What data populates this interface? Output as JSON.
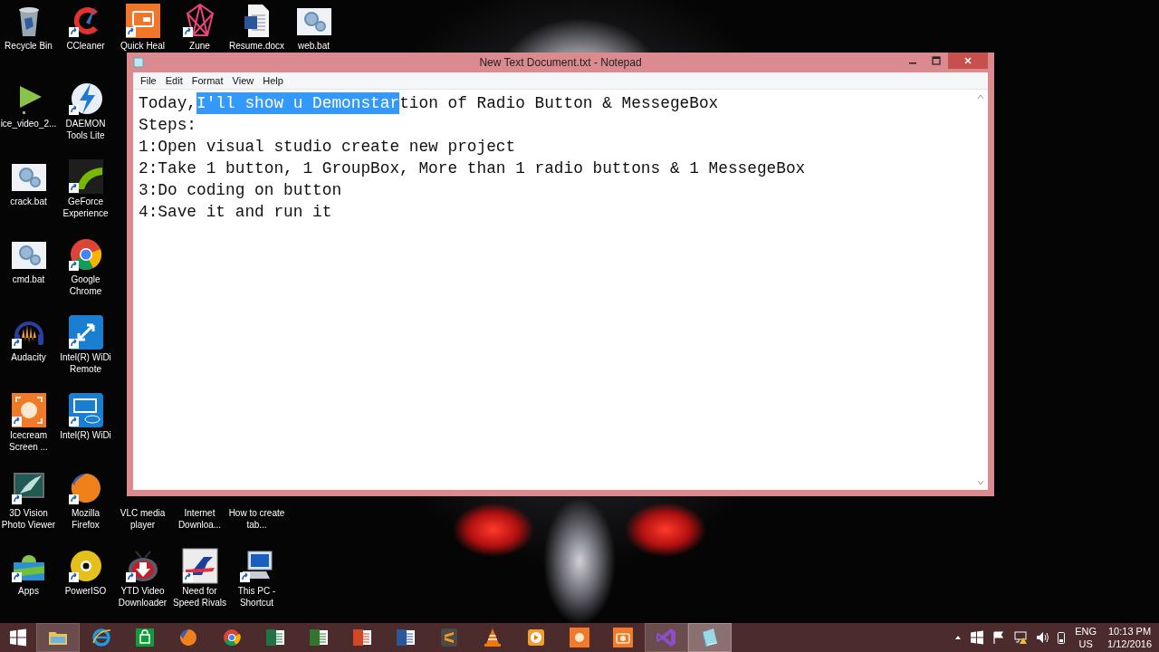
{
  "desktop_rows": [
    [
      {
        "label": "Recycle Bin",
        "kind": "bin",
        "shortcut": false
      },
      {
        "label": "CCleaner",
        "kind": "ccleaner",
        "shortcut": true
      },
      {
        "label": "Quick Heal",
        "kind": "quickheal",
        "shortcut": true
      },
      {
        "label": "Zune",
        "kind": "zune",
        "shortcut": true
      },
      {
        "label": "Resume.docx",
        "kind": "worddoc",
        "shortcut": false
      },
      {
        "label": "web.bat",
        "kind": "bat",
        "shortcut": false
      }
    ],
    [
      {
        "label": "ice_video_2...",
        "kind": "play",
        "shortcut": false
      },
      {
        "label": "DAEMON Tools Lite",
        "kind": "daemon",
        "shortcut": true
      }
    ],
    [
      {
        "label": "crack.bat",
        "kind": "bat",
        "shortcut": false
      },
      {
        "label": "GeForce Experience",
        "kind": "nvidia",
        "shortcut": true
      }
    ],
    [
      {
        "label": "cmd.bat",
        "kind": "bat",
        "shortcut": false
      },
      {
        "label": "Google Chrome",
        "kind": "chrome",
        "shortcut": true
      }
    ],
    [
      {
        "label": "Audacity",
        "kind": "audacity",
        "shortcut": true
      },
      {
        "label": "Intel(R) WiDi Remote",
        "kind": "intelremote",
        "shortcut": true
      }
    ],
    [
      {
        "label": "Icecream Screen ...",
        "kind": "icecream",
        "shortcut": true
      },
      {
        "label": "Intel(R) WiDi",
        "kind": "intelwidi",
        "shortcut": true
      }
    ],
    [
      {
        "label": "3D Vision Photo Viewer",
        "kind": "vision",
        "shortcut": true
      },
      {
        "label": "Mozilla Firefox",
        "kind": "firefox",
        "shortcut": true
      },
      {
        "label": "VLC media player"
      },
      {
        "label": "Internet Downloa..."
      },
      {
        "label": "How to create tab..."
      }
    ],
    [
      {
        "label": "Apps",
        "kind": "android",
        "shortcut": true
      },
      {
        "label": "PowerISO",
        "kind": "disc",
        "shortcut": true
      },
      {
        "label": "YTD Video Downloader",
        "kind": "ytd",
        "shortcut": true
      },
      {
        "label": "Need for Speed Rivals",
        "kind": "nfs",
        "shortcut": true
      },
      {
        "label": "This PC - Shortcut",
        "kind": "pc",
        "shortcut": true
      }
    ]
  ],
  "window": {
    "title": "New Text Document.txt - Notepad",
    "menu": [
      "File",
      "Edit",
      "Format",
      "View",
      "Help"
    ],
    "lines": [
      {
        "segments": [
          {
            "text": "Today,",
            "selected": false
          },
          {
            "text": "I'll show u Demonstar",
            "selected": true
          },
          {
            "text": "tion of Radio Button & MessegeBox",
            "selected": false
          }
        ]
      },
      {
        "segments": [
          {
            "text": "Steps:",
            "selected": false
          }
        ]
      },
      {
        "segments": [
          {
            "text": "1:Open visual studio create new project",
            "selected": false
          }
        ]
      },
      {
        "segments": [
          {
            "text": "2:Take 1 button, 1 GroupBox, More than 1 radio buttons & 1 MessegeBox",
            "selected": false
          }
        ]
      },
      {
        "segments": [
          {
            "text": "3:Do coding on button",
            "selected": false
          }
        ]
      },
      {
        "segments": [
          {
            "text": "4:Save it and run it",
            "selected": false
          }
        ]
      }
    ]
  },
  "taskbar": {
    "apps": [
      {
        "kind": "explorer",
        "running": true,
        "selected": false
      },
      {
        "kind": "ie",
        "running": false,
        "selected": false
      },
      {
        "kind": "store",
        "running": false,
        "selected": false
      },
      {
        "kind": "firefox",
        "running": false,
        "selected": false
      },
      {
        "kind": "chrome",
        "running": false,
        "selected": false
      },
      {
        "kind": "excel",
        "running": false,
        "selected": false
      },
      {
        "kind": "project",
        "running": false,
        "selected": false
      },
      {
        "kind": "powerpoint",
        "running": false,
        "selected": false
      },
      {
        "kind": "word",
        "running": false,
        "selected": false
      },
      {
        "kind": "sublime",
        "running": false,
        "selected": false
      },
      {
        "kind": "vlc",
        "running": false,
        "selected": false
      },
      {
        "kind": "player",
        "running": false,
        "selected": false
      },
      {
        "kind": "icecream",
        "running": false,
        "selected": false
      },
      {
        "kind": "camera",
        "running": false,
        "selected": false
      },
      {
        "kind": "vs",
        "running": true,
        "selected": false
      },
      {
        "kind": "notepad",
        "running": true,
        "selected": true
      }
    ],
    "language": "ENG",
    "region": "US",
    "time": "10:13 PM",
    "date": "1/12/2016"
  }
}
